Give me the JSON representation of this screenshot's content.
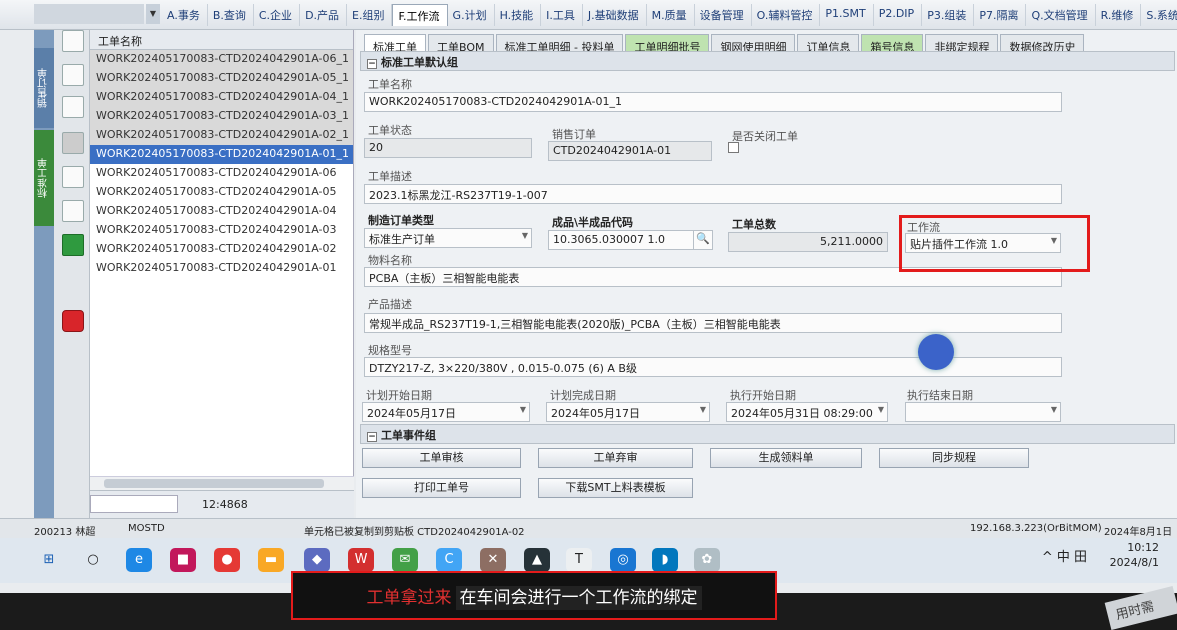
{
  "menu": [
    "A.事务",
    "B.查询",
    "C.企业",
    "D.产品",
    "E.组别",
    "F.工作流",
    "G.计划",
    "H.技能",
    "I.工具",
    "J.基础数据",
    "M.质量",
    "设备管理",
    "O.辅料管控",
    "P1.SMT",
    "P2.DIP",
    "P3.组装",
    "P7.隔离",
    "Q.文档管理",
    "R.维修",
    "S.系统"
  ],
  "active_menu_index": 5,
  "leftbar": {
    "tab1": "销售订单",
    "tab2": "标准工单"
  },
  "list": {
    "header": "工单名称",
    "items": [
      "WORK202405170083-CTD2024042901A-06_1",
      "WORK202405170083-CTD2024042901A-05_1",
      "WORK202405170083-CTD2024042901A-04_1",
      "WORK202405170083-CTD2024042901A-03_1",
      "WORK202405170083-CTD2024042901A-02_1",
      "WORK202405170083-CTD2024042901A-01_1",
      "WORK202405170083-CTD2024042901A-06",
      "WORK202405170083-CTD2024042901A-05",
      "WORK202405170083-CTD2024042901A-04",
      "WORK202405170083-CTD2024042901A-03",
      "WORK202405170083-CTD2024042901A-02",
      "WORK202405170083-CTD2024042901A-01"
    ],
    "count": "12:4868"
  },
  "tabs": [
    "标准工单",
    "工单BOM",
    "标准工单明细 - 投料单",
    "工单明细批号",
    "钢网使用明细",
    "订单信息",
    "箱号信息",
    "非绑定规程",
    "数据修改历史"
  ],
  "group1": {
    "title": "标准工单默认组"
  },
  "form": {
    "work_order_name_label": "工单名称",
    "work_order_name": "WORK202405170083-CTD2024042901A-01_1",
    "status_label": "工单状态",
    "status": "20",
    "sales_order_label": "销售订单",
    "sales_order": "CTD2024042901A-01",
    "closed_label": "是否关闭工单",
    "desc_label": "工单描述",
    "desc": "2023.1标黑龙江-RS237T19-1-007",
    "type_label": "制造订单类型",
    "type": "标准生产订单",
    "product_code_label": "成品\\半成品代码",
    "product_code": "10.3065.030007 1.0",
    "total_label": "工单总数",
    "total": "5,211.0000",
    "workflow_label": "工作流",
    "workflow": "贴片插件工作流 1.0",
    "material_label": "物料名称",
    "material": "PCBA（主板）三相智能电能表",
    "product_desc_label": "产品描述",
    "product_desc": "常规半成品_RS237T19-1,三相智能电能表(2020版)_PCBA（主板）三相智能电能表",
    "spec_label": "规格型号",
    "spec": "DTZY217-Z, 3×220/380V , 0.015-0.075 (6) A B级",
    "plan_start_label": "计划开始日期",
    "plan_start": "2024年05月17日",
    "plan_end_label": "计划完成日期",
    "plan_end": "2024年05月17日",
    "exec_start_label": "执行开始日期",
    "exec_start": "2024年05月31日 08:29:00",
    "exec_end_label": "执行结束日期"
  },
  "group2": {
    "title": "工单事件组"
  },
  "buttons": {
    "audit": "工单审核",
    "abandon": "工单弃审",
    "gen_material": "生成领料单",
    "sync": "同步规程",
    "print": "打印工单号",
    "download": "下载SMT上料表模板"
  },
  "status": {
    "user": "200213 林超",
    "db": "MOSTD",
    "msg": "单元格已被复制到剪贴板 CTD2024042901A-02",
    "server": "192.168.3.223(OrBitMOM)",
    "date": "2024年8月1日"
  },
  "taskbar": {
    "time": "10:12",
    "date": "2024/8/1",
    "lang": "中"
  },
  "subtitle": {
    "red": "工单拿过来",
    "white": "在车间会进行一个工作流的绑定"
  },
  "corner_text": "用时需",
  "colors": {
    "highlight_box": "#e31b1b",
    "selection": "#3a6fc4"
  }
}
